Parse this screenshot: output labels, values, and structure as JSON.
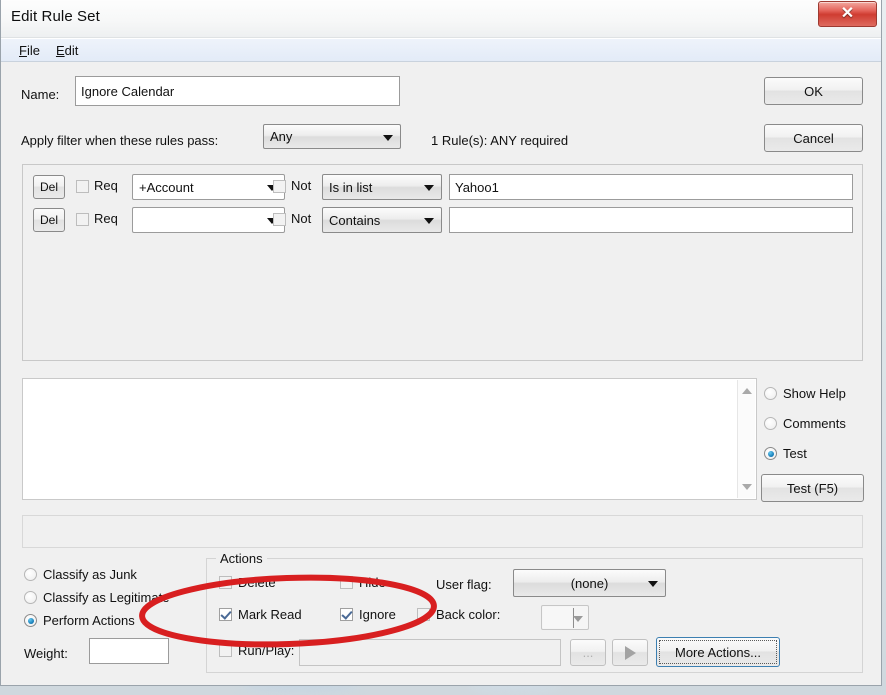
{
  "window": {
    "title": "Edit Rule Set",
    "close_icon": "close-x-icon"
  },
  "menubar": {
    "items": [
      {
        "label": "File",
        "accel": "F"
      },
      {
        "label": "Edit",
        "accel": "E"
      }
    ]
  },
  "header": {
    "name_label": "Name:",
    "name_value": "Ignore Calendar",
    "apply_label": "Apply filter when these rules pass:",
    "apply_value": "Any",
    "rules_status": "1 Rule(s): ANY required",
    "ok_label": "OK",
    "cancel_label": "Cancel"
  },
  "rules": {
    "del_label": "Del",
    "req_label": "Req",
    "not_label": "Not",
    "rows": [
      {
        "del": "Del",
        "req_checked": false,
        "field": "+Account",
        "not_checked": false,
        "operator": "Is in list",
        "value": "Yahoo1"
      },
      {
        "del": "Del",
        "req_checked": false,
        "field": "",
        "not_checked": false,
        "operator": "Contains",
        "value": ""
      }
    ]
  },
  "output": {
    "text": "",
    "scroll_up_icon": "scroll-up-arrow-icon",
    "scroll_down_icon": "scroll-down-arrow-icon",
    "status_text": ""
  },
  "mode_radios": {
    "items": [
      {
        "label": "Show Help",
        "selected": false
      },
      {
        "label": "Comments",
        "selected": false
      },
      {
        "label": "Test",
        "selected": true
      }
    ],
    "test_button": "Test (F5)"
  },
  "classify": {
    "items": [
      {
        "label": "Classify as Junk",
        "selected": false
      },
      {
        "label": "Classify as Legitimate",
        "selected": false
      },
      {
        "label": "Perform Actions",
        "selected": true
      }
    ],
    "weight_label": "Weight:",
    "weight_value": ""
  },
  "actions": {
    "caption": "Actions",
    "checkboxes": [
      {
        "label": "Delete",
        "checked": false
      },
      {
        "label": "Hide",
        "checked": false
      },
      {
        "label": "Mark Read",
        "checked": true
      },
      {
        "label": "Ignore",
        "checked": true
      },
      {
        "label": "Back color:",
        "checked": false
      },
      {
        "label": "Run/Play:",
        "checked": false
      }
    ],
    "user_flag_label": "User flag:",
    "user_flag_value": "(none)",
    "back_color_value": "",
    "run_play_value": "",
    "browse_label": "...",
    "play_icon": "play-triangle-icon",
    "more_actions_label": "More Actions..."
  },
  "annotation": {
    "shape": "red-ellipse-highlight",
    "color": "#d81f20"
  }
}
